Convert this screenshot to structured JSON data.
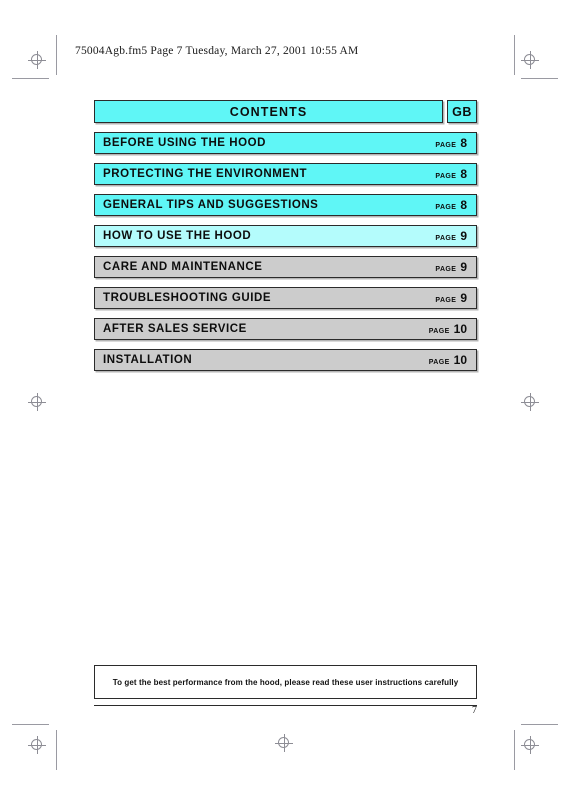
{
  "header": {
    "fm_line": "75004Agb.fm5  Page 7  Tuesday, March 27, 2001  10:55 AM"
  },
  "contents": {
    "title": "CONTENTS",
    "language_code": "GB",
    "page_word": "PAGE",
    "items": [
      {
        "label": "BEFORE USING THE HOOD",
        "page_word": "PAGE",
        "page": "8",
        "color": "#5ff6f6"
      },
      {
        "label": "PROTECTING THE ENVIRONMENT",
        "page_word": "PAGE",
        "page": "8",
        "color": "#5ff6f6"
      },
      {
        "label": "GENERAL TIPS AND SUGGESTIONS",
        "page_word": "PAGE",
        "page": "8",
        "color": "#5ff6f6"
      },
      {
        "label": "HOW TO USE THE HOOD",
        "page_word": "PAGE",
        "page": "9",
        "color": "#b4fcfc"
      },
      {
        "label": "CARE AND MAINTENANCE",
        "page_word": "PAGE",
        "page": "9",
        "color": "#cccccc"
      },
      {
        "label": "TROUBLESHOOTING GUIDE",
        "page_word": "PAGE",
        "page": "9",
        "color": "#cccccc"
      },
      {
        "label": "AFTER SALES SERVICE",
        "page_word": "PAGE",
        "page": "10",
        "color": "#cccccc"
      },
      {
        "label": "INSTALLATION",
        "page_word": "PAGE",
        "page": "10",
        "color": "#cccccc"
      }
    ]
  },
  "footer": {
    "note": "To get the best performance from the hood, please read these user instructions carefully",
    "page_number": "7"
  },
  "colors": {
    "accent_cyan": "#5ff6f6",
    "accent_pale_cyan": "#b4fcfc",
    "accent_gray": "#cccccc",
    "border": "#2b2b2b",
    "regmark": "#8d8d95"
  }
}
